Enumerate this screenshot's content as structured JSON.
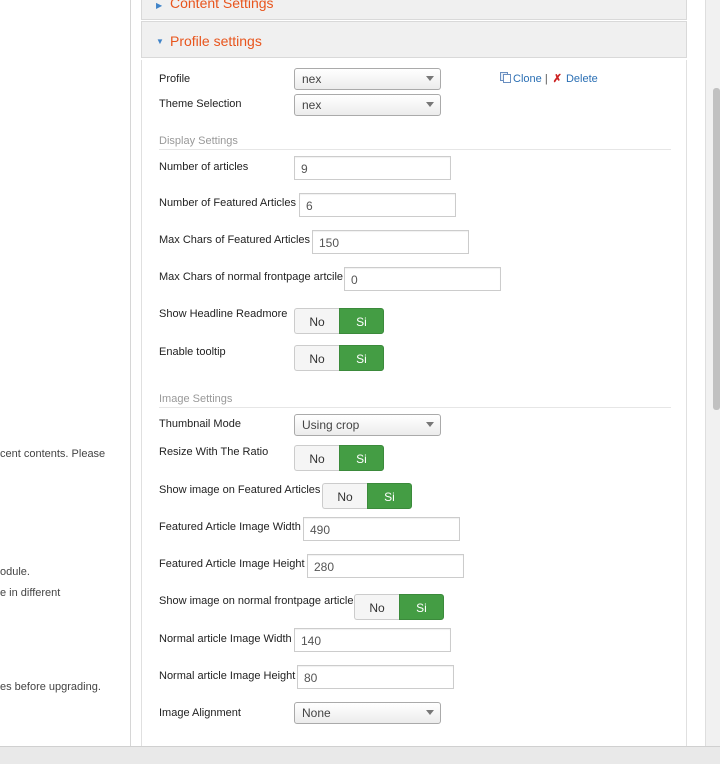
{
  "left_notes": [
    "cent contents. Please",
    "odule.",
    "e in different",
    "es before upgrading."
  ],
  "panels": {
    "content": {
      "title": "Content Settings"
    },
    "profile": {
      "title": "Profile settings"
    }
  },
  "profile": {
    "label": "Profile",
    "value": "nex",
    "clone_label": "Clone",
    "separator": "|",
    "delete_label": "Delete"
  },
  "theme": {
    "label": "Theme Selection",
    "value": "nex"
  },
  "display_settings": {
    "heading": "Display Settings",
    "num_articles": {
      "label": "Number of articles",
      "value": "9"
    },
    "num_featured": {
      "label": "Number of Featured Articles",
      "value": "6"
    },
    "max_chars_featured": {
      "label": "Max Chars of Featured Articles",
      "value": "150"
    },
    "max_chars_normal": {
      "label": "Max Chars of normal frontpage artcile",
      "value": "0"
    },
    "headline_readmore": {
      "label": "Show Headline Readmore",
      "no": "No",
      "yes": "Si",
      "selected": "Si"
    },
    "tooltip": {
      "label": "Enable tooltip",
      "no": "No",
      "yes": "Si",
      "selected": "Si"
    }
  },
  "image_settings": {
    "heading": "Image Settings",
    "thumbnail_mode": {
      "label": "Thumbnail Mode",
      "value": "Using crop"
    },
    "resize_ratio": {
      "label": "Resize With The Ratio",
      "no": "No",
      "yes": "Si",
      "selected": "Si"
    },
    "show_featured": {
      "label": "Show image on Featured Articles",
      "no": "No",
      "yes": "Si",
      "selected": "Si"
    },
    "featured_width": {
      "label": "Featured Article Image Width",
      "value": "490"
    },
    "featured_height": {
      "label": "Featured Article Image Height",
      "value": "280"
    },
    "show_normal": {
      "label": "Show image on normal frontpage article",
      "no": "No",
      "yes": "Si",
      "selected": "Si"
    },
    "normal_width": {
      "label": "Normal article Image Width",
      "value": "140"
    },
    "normal_height": {
      "label": "Normal article Image Height",
      "value": "80"
    },
    "alignment": {
      "label": "Image Alignment",
      "value": "None"
    }
  },
  "colors": {
    "accent_title": "#e8551d",
    "toggle_active": "#449d44",
    "link": "#2a6fb4"
  }
}
